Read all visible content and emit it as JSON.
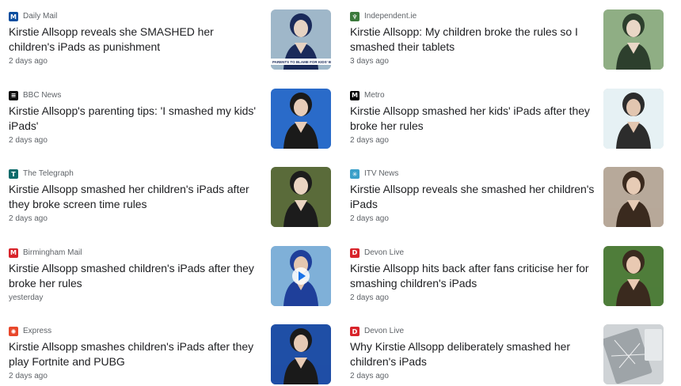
{
  "articles": [
    {
      "source": "Daily Mail",
      "logo": {
        "icon": "daily-mail-logo",
        "glyph": "M",
        "bg": "#0a4fa0"
      },
      "headline": "Kirstie Allsopp reveals she SMASHED her children's iPads as punishment",
      "time": "2 days ago",
      "thumb": {
        "bg": "#9fb7c9",
        "accent": "#1a2a5a",
        "subject": "#e6d2c2",
        "caption": "PARENTS TO BLAME FOR KIDS' BEHAVIOUR?"
      }
    },
    {
      "source": "Independent.ie",
      "logo": {
        "icon": "harp-icon",
        "glyph": "♆",
        "bg": "#3c7a3c"
      },
      "headline": "Kirstie Allsopp: My children broke the rules so I smashed their tablets",
      "time": "3 days ago",
      "thumb": {
        "bg": "#8fae84",
        "accent": "#2d3f2d",
        "subject": "#e9d6c6"
      }
    },
    {
      "source": "BBC News",
      "logo": {
        "icon": "bbc-logo",
        "glyph": "≡",
        "bg": "#111111"
      },
      "headline": "Kirstie Allsopp's parenting tips: 'I smashed my kids' iPads'",
      "time": "2 days ago",
      "thumb": {
        "bg": "#2a6bc9",
        "accent": "#1a1a1a",
        "subject": "#e8cdb8"
      }
    },
    {
      "source": "Metro",
      "logo": {
        "icon": "metro-logo",
        "glyph": "M",
        "bg": "#000000"
      },
      "headline": "Kirstie Allsopp smashed her kids' iPads after they broke her rules",
      "time": "2 days ago",
      "thumb": {
        "bg": "#e6f1f4",
        "accent": "#2c2c2c",
        "subject": "#e2c6b0"
      }
    },
    {
      "source": "The Telegraph",
      "logo": {
        "icon": "telegraph-logo",
        "glyph": "T",
        "bg": "#0b6b6b"
      },
      "headline": "Kirstie Allsopp smashed her children's iPads after they broke screen time rules",
      "time": "2 days ago",
      "thumb": {
        "bg": "#5a6b3a",
        "accent": "#1c1c1c",
        "subject": "#ead4c2"
      }
    },
    {
      "source": "ITV News",
      "logo": {
        "icon": "itv-logo",
        "glyph": "✳",
        "bg": "#3aa0c9"
      },
      "headline": "Kirstie Allsopp reveals she smashed her children's iPads",
      "time": "2 days ago",
      "thumb": {
        "bg": "#b7a99a",
        "accent": "#3a2a1e",
        "subject": "#e6cbb5"
      }
    },
    {
      "source": "Birmingham Mail",
      "logo": {
        "icon": "birmingham-mail-logo",
        "glyph": "M",
        "bg": "#d8242b"
      },
      "headline": "Kirstie Allsopp smashed children's iPads after they broke her rules",
      "time": "yesterday",
      "thumb": {
        "bg": "#7fb0d8",
        "accent": "#1f3f9a",
        "subject": "#e4c7b0",
        "video": true
      }
    },
    {
      "source": "Devon Live",
      "logo": {
        "icon": "devon-live-logo",
        "glyph": "D",
        "bg": "#d8242b"
      },
      "headline": "Kirstie Allsopp hits back after fans criticise her for smashing children's iPads",
      "time": "2 days ago",
      "thumb": {
        "bg": "#4f7d3a",
        "accent": "#3a2a1e",
        "subject": "#e9c9b2"
      }
    },
    {
      "source": "Express",
      "logo": {
        "icon": "express-logo",
        "glyph": "✺",
        "bg": "#e8472b"
      },
      "headline": "Kirstie Allsopp smashes children's iPads after they play Fortnite and PUBG",
      "time": "2 days ago",
      "thumb": {
        "bg": "#1f4fa6",
        "accent": "#1a1a1a",
        "subject": "#e6cab4"
      }
    },
    {
      "source": "Devon Live",
      "logo": {
        "icon": "devon-live-logo",
        "glyph": "D",
        "bg": "#d8242b"
      },
      "headline": "Why Kirstie Allsopp deliberately smashed her children's iPads",
      "time": "2 days ago",
      "thumb": {
        "bg": "#cfd3d6",
        "accent": "#6f7478",
        "subject": "#9ea4a8",
        "cracked": true
      }
    }
  ]
}
